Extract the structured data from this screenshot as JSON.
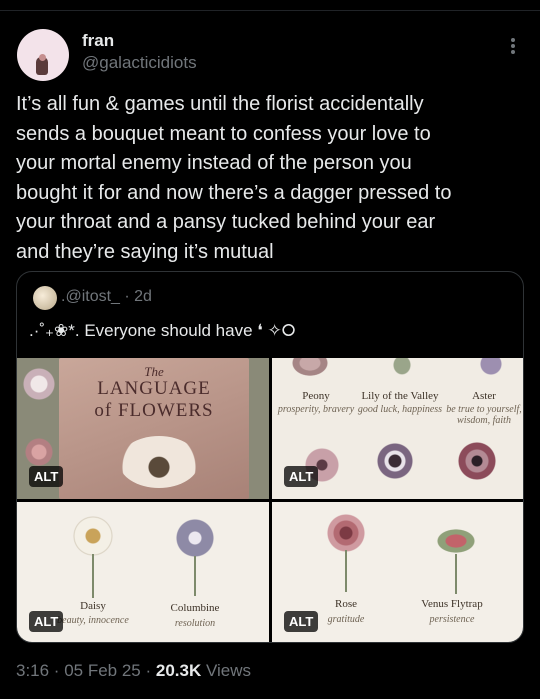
{
  "author": {
    "name": "fran",
    "handle": "@galacticidiots"
  },
  "tweet": {
    "text": "It’s all fun & games until the florist accidentally\nsends a bouquet meant to confess your love to\nyour mortal enemy instead of the person you\nbought it for and now there’s a dagger pressed to\nyour throat and a pansy tucked behind your ear\nand they’re saying it’s mutual"
  },
  "quote": {
    "handle": ".@itost_ · 2d",
    "text": ".·˚₊❀*. Everyone should have ❛ ✧⭘",
    "images": [
      {
        "alt": "ALT",
        "book": {
          "line1": "The",
          "line2": "LANGUAGE",
          "line3": "of FLOWERS"
        }
      },
      {
        "alt": "ALT",
        "flowers": [
          {
            "name": "Peony",
            "meaning": "prosperity, bravery"
          },
          {
            "name": "Lily of the Valley",
            "meaning": "good luck, happiness"
          },
          {
            "name": "Aster",
            "meaning": "be true to yourself,\nwisdom, faith"
          }
        ]
      },
      {
        "alt": "ALT",
        "flowers": [
          {
            "name": "Daisy",
            "meaning": "beauty, innocence"
          },
          {
            "name": "Columbine",
            "meaning": "resolution"
          }
        ]
      },
      {
        "alt": "ALT",
        "flowers": [
          {
            "name": "Rose",
            "meaning": "gratitude"
          },
          {
            "name": "Venus Flytrap",
            "meaning": "persistence"
          }
        ]
      }
    ]
  },
  "meta": {
    "time": "3:16 · 05 Feb 25 · ",
    "views_count": "20.3K",
    "views_label": " Views"
  }
}
